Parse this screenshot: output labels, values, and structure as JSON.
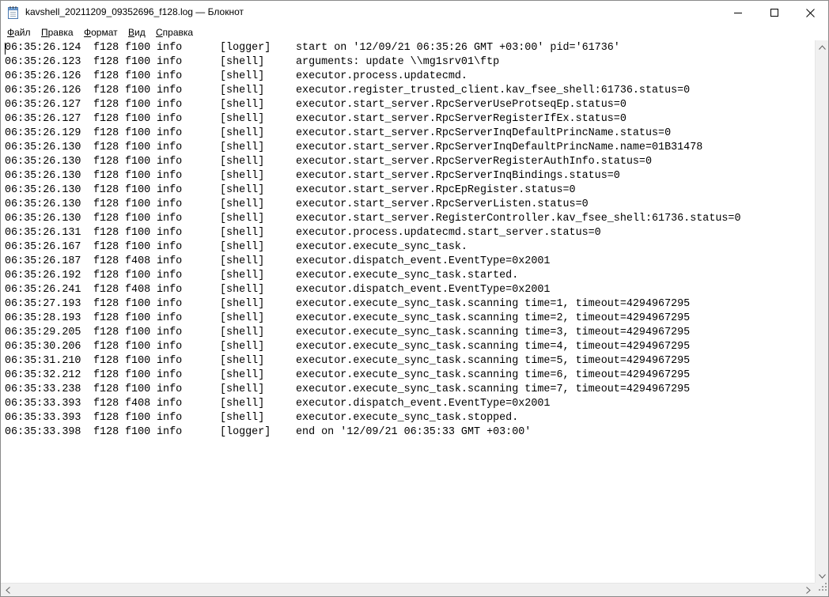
{
  "window": {
    "title": "kavshell_20211209_09352696_f128.log — Блокнот"
  },
  "icons": {
    "app": "notepad-icon",
    "minimize": "minimize-icon",
    "maximize": "maximize-icon",
    "close": "close-icon"
  },
  "menu": [
    {
      "accel": "Ф",
      "rest": "айл"
    },
    {
      "accel": "П",
      "rest": "равка"
    },
    {
      "accel": "Ф",
      "rest": "ормат"
    },
    {
      "accel": "В",
      "rest": "ид"
    },
    {
      "accel": "С",
      "rest": "правка"
    }
  ],
  "log": [
    {
      "time": "06:35:26.124",
      "pid": "f128",
      "tid": "f100",
      "level": "info",
      "source": "[logger]",
      "message": "start on '12/09/21 06:35:26 GMT +03:00' pid='61736'"
    },
    {
      "time": "06:35:26.123",
      "pid": "f128",
      "tid": "f100",
      "level": "info",
      "source": "[shell]",
      "message": "arguments: update \\\\mg1srv01\\ftp"
    },
    {
      "time": "06:35:26.126",
      "pid": "f128",
      "tid": "f100",
      "level": "info",
      "source": "[shell]",
      "message": "executor.process.updatecmd."
    },
    {
      "time": "06:35:26.126",
      "pid": "f128",
      "tid": "f100",
      "level": "info",
      "source": "[shell]",
      "message": "executor.register_trusted_client.kav_fsee_shell:61736.status=0"
    },
    {
      "time": "06:35:26.127",
      "pid": "f128",
      "tid": "f100",
      "level": "info",
      "source": "[shell]",
      "message": "executor.start_server.RpcServerUseProtseqEp.status=0"
    },
    {
      "time": "06:35:26.127",
      "pid": "f128",
      "tid": "f100",
      "level": "info",
      "source": "[shell]",
      "message": "executor.start_server.RpcServerRegisterIfEx.status=0"
    },
    {
      "time": "06:35:26.129",
      "pid": "f128",
      "tid": "f100",
      "level": "info",
      "source": "[shell]",
      "message": "executor.start_server.RpcServerInqDefaultPrincName.status=0"
    },
    {
      "time": "06:35:26.130",
      "pid": "f128",
      "tid": "f100",
      "level": "info",
      "source": "[shell]",
      "message": "executor.start_server.RpcServerInqDefaultPrincName.name=01B31478"
    },
    {
      "time": "06:35:26.130",
      "pid": "f128",
      "tid": "f100",
      "level": "info",
      "source": "[shell]",
      "message": "executor.start_server.RpcServerRegisterAuthInfo.status=0"
    },
    {
      "time": "06:35:26.130",
      "pid": "f128",
      "tid": "f100",
      "level": "info",
      "source": "[shell]",
      "message": "executor.start_server.RpcServerInqBindings.status=0"
    },
    {
      "time": "06:35:26.130",
      "pid": "f128",
      "tid": "f100",
      "level": "info",
      "source": "[shell]",
      "message": "executor.start_server.RpcEpRegister.status=0"
    },
    {
      "time": "06:35:26.130",
      "pid": "f128",
      "tid": "f100",
      "level": "info",
      "source": "[shell]",
      "message": "executor.start_server.RpcServerListen.status=0"
    },
    {
      "time": "06:35:26.130",
      "pid": "f128",
      "tid": "f100",
      "level": "info",
      "source": "[shell]",
      "message": "executor.start_server.RegisterController.kav_fsee_shell:61736.status=0"
    },
    {
      "time": "06:35:26.131",
      "pid": "f128",
      "tid": "f100",
      "level": "info",
      "source": "[shell]",
      "message": "executor.process.updatecmd.start_server.status=0"
    },
    {
      "time": "06:35:26.167",
      "pid": "f128",
      "tid": "f100",
      "level": "info",
      "source": "[shell]",
      "message": "executor.execute_sync_task."
    },
    {
      "time": "06:35:26.187",
      "pid": "f128",
      "tid": "f408",
      "level": "info",
      "source": "[shell]",
      "message": "executor.dispatch_event.EventType=0x2001"
    },
    {
      "time": "06:35:26.192",
      "pid": "f128",
      "tid": "f100",
      "level": "info",
      "source": "[shell]",
      "message": "executor.execute_sync_task.started."
    },
    {
      "time": "06:35:26.241",
      "pid": "f128",
      "tid": "f408",
      "level": "info",
      "source": "[shell]",
      "message": "executor.dispatch_event.EventType=0x2001"
    },
    {
      "time": "06:35:27.193",
      "pid": "f128",
      "tid": "f100",
      "level": "info",
      "source": "[shell]",
      "message": "executor.execute_sync_task.scanning time=1, timeout=4294967295"
    },
    {
      "time": "06:35:28.193",
      "pid": "f128",
      "tid": "f100",
      "level": "info",
      "source": "[shell]",
      "message": "executor.execute_sync_task.scanning time=2, timeout=4294967295"
    },
    {
      "time": "06:35:29.205",
      "pid": "f128",
      "tid": "f100",
      "level": "info",
      "source": "[shell]",
      "message": "executor.execute_sync_task.scanning time=3, timeout=4294967295"
    },
    {
      "time": "06:35:30.206",
      "pid": "f128",
      "tid": "f100",
      "level": "info",
      "source": "[shell]",
      "message": "executor.execute_sync_task.scanning time=4, timeout=4294967295"
    },
    {
      "time": "06:35:31.210",
      "pid": "f128",
      "tid": "f100",
      "level": "info",
      "source": "[shell]",
      "message": "executor.execute_sync_task.scanning time=5, timeout=4294967295"
    },
    {
      "time": "06:35:32.212",
      "pid": "f128",
      "tid": "f100",
      "level": "info",
      "source": "[shell]",
      "message": "executor.execute_sync_task.scanning time=6, timeout=4294967295"
    },
    {
      "time": "06:35:33.238",
      "pid": "f128",
      "tid": "f100",
      "level": "info",
      "source": "[shell]",
      "message": "executor.execute_sync_task.scanning time=7, timeout=4294967295"
    },
    {
      "time": "06:35:33.393",
      "pid": "f128",
      "tid": "f408",
      "level": "info",
      "source": "[shell]",
      "message": "executor.dispatch_event.EventType=0x2001"
    },
    {
      "time": "06:35:33.393",
      "pid": "f128",
      "tid": "f100",
      "level": "info",
      "source": "[shell]",
      "message": "executor.execute_sync_task.stopped."
    },
    {
      "time": "06:35:33.398",
      "pid": "f128",
      "tid": "f100",
      "level": "info",
      "source": "[logger]",
      "message": "end on '12/09/21 06:35:33 GMT +03:00'"
    }
  ]
}
